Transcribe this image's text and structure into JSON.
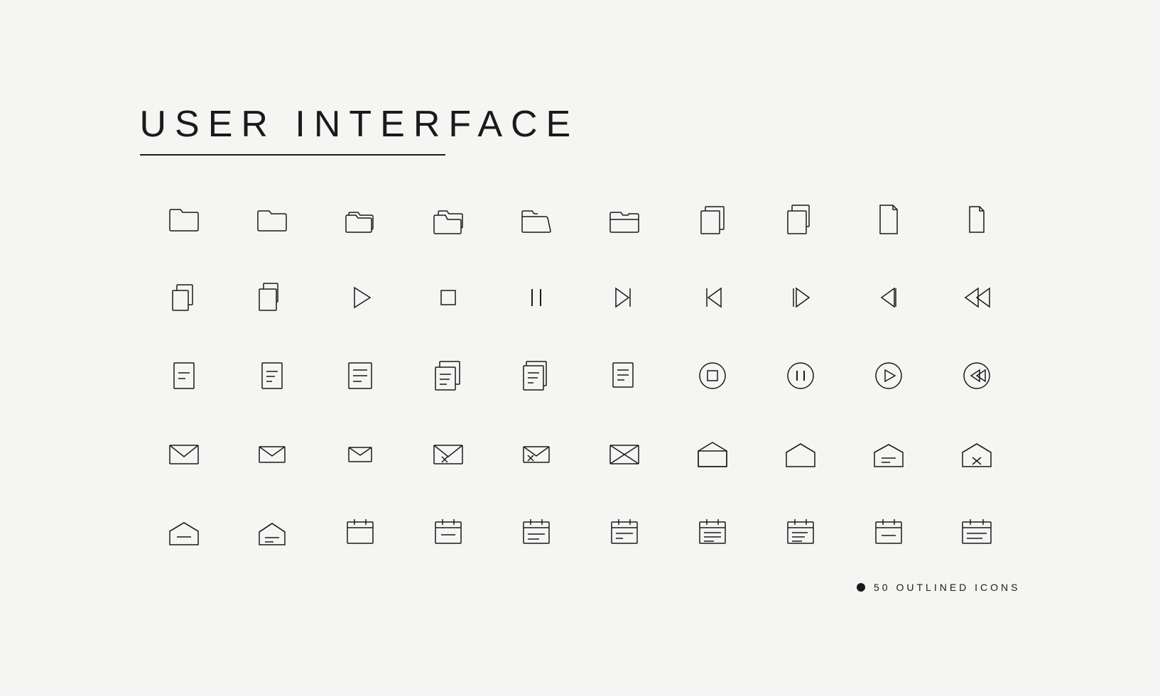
{
  "header": {
    "title": "USER INTERFACE",
    "subtitle": "50 OUTLINED ICONS"
  },
  "icons": [
    {
      "name": "folder-1",
      "row": 1
    },
    {
      "name": "folder-2",
      "row": 1
    },
    {
      "name": "folder-multiple-1",
      "row": 1
    },
    {
      "name": "folder-multiple-2",
      "row": 1
    },
    {
      "name": "folder-open-1",
      "row": 1
    },
    {
      "name": "folder-open-2",
      "row": 1
    },
    {
      "name": "copy-1",
      "row": 1
    },
    {
      "name": "copy-2",
      "row": 1
    },
    {
      "name": "file-1",
      "row": 1
    },
    {
      "name": "file-2",
      "row": 1
    },
    {
      "name": "files-1",
      "row": 2
    },
    {
      "name": "files-2",
      "row": 2
    },
    {
      "name": "play",
      "row": 2
    },
    {
      "name": "stop",
      "row": 2
    },
    {
      "name": "pause",
      "row": 2
    },
    {
      "name": "next",
      "row": 2
    },
    {
      "name": "prev",
      "row": 2
    },
    {
      "name": "forward",
      "row": 2
    },
    {
      "name": "rewind",
      "row": 2
    },
    {
      "name": "fast-rewind",
      "row": 2
    },
    {
      "name": "doc-minus-1",
      "row": 3
    },
    {
      "name": "doc-minus-2",
      "row": 3
    },
    {
      "name": "doc-list-1",
      "row": 3
    },
    {
      "name": "doc-list-2",
      "row": 3
    },
    {
      "name": "doc-list-3",
      "row": 3
    },
    {
      "name": "doc-list-4",
      "row": 3
    },
    {
      "name": "stop-circle",
      "row": 3
    },
    {
      "name": "pause-circle",
      "row": 3
    },
    {
      "name": "play-circle",
      "row": 3
    },
    {
      "name": "rewind-circle",
      "row": 3
    },
    {
      "name": "mail-1",
      "row": 4
    },
    {
      "name": "mail-2",
      "row": 4
    },
    {
      "name": "mail-3",
      "row": 4
    },
    {
      "name": "mail-x-1",
      "row": 4
    },
    {
      "name": "mail-x-2",
      "row": 4
    },
    {
      "name": "mail-x-3",
      "row": 4
    },
    {
      "name": "mail-open-1",
      "row": 4
    },
    {
      "name": "mail-open-2",
      "row": 4
    },
    {
      "name": "mail-open-3",
      "row": 4
    },
    {
      "name": "mail-open-x",
      "row": 4
    },
    {
      "name": "mail-open-4",
      "row": 5
    },
    {
      "name": "mail-open-5",
      "row": 5
    },
    {
      "name": "calendar-1",
      "row": 5
    },
    {
      "name": "calendar-2",
      "row": 5
    },
    {
      "name": "calendar-3",
      "row": 5
    },
    {
      "name": "calendar-4",
      "row": 5
    },
    {
      "name": "calendar-5",
      "row": 5
    },
    {
      "name": "calendar-6",
      "row": 5
    },
    {
      "name": "calendar-7",
      "row": 5
    },
    {
      "name": "calendar-8",
      "row": 5
    }
  ]
}
